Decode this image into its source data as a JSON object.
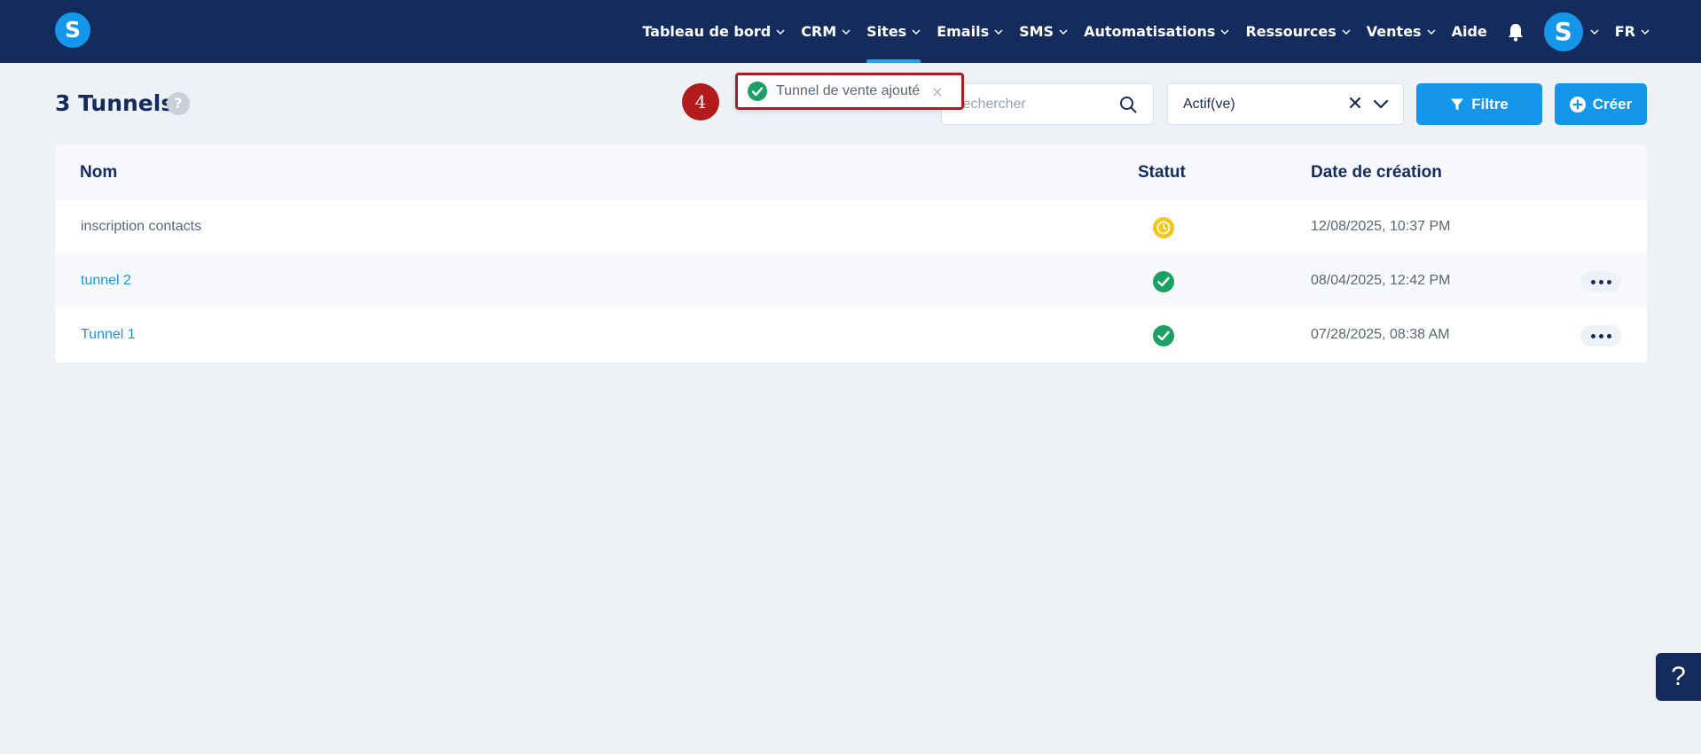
{
  "nav": {
    "logo_letter": "S",
    "items": [
      {
        "label": "Tableau de bord"
      },
      {
        "label": "CRM"
      },
      {
        "label": "Sites"
      },
      {
        "label": "Emails"
      },
      {
        "label": "SMS"
      },
      {
        "label": "Automatisations"
      },
      {
        "label": "Ressources"
      },
      {
        "label": "Ventes"
      },
      {
        "label": "Aide"
      }
    ],
    "active_item": "Sites",
    "avatar_letter": "S",
    "language": "FR"
  },
  "header": {
    "title": "3 Tunnels",
    "help_label": "?",
    "step_badge": "4",
    "search_placeholder": "Rechercher",
    "status_filter_value": "Actif(ve)",
    "filter_button": "Filtre",
    "create_button": "Créer"
  },
  "toast": {
    "message": "Tunnel de vente ajouté",
    "close_label": "×"
  },
  "table": {
    "columns": {
      "name": "Nom",
      "status": "Statut",
      "date": "Date de création"
    },
    "rows": [
      {
        "name": "inscription contacts",
        "status": "pending",
        "date": "12/08/2025, 10:37 PM"
      },
      {
        "name": "tunnel 2",
        "status": "active",
        "date": "08/04/2025, 12:42 PM"
      },
      {
        "name": "Tunnel 1",
        "status": "active",
        "date": "07/28/2025, 08:38 AM"
      }
    ]
  },
  "float_help": "?",
  "colors": {
    "nav_bg": "#142b5e",
    "accent": "#1497ea",
    "success": "#1aa163",
    "pending": "#f5c518",
    "toast_border": "#a32025"
  }
}
